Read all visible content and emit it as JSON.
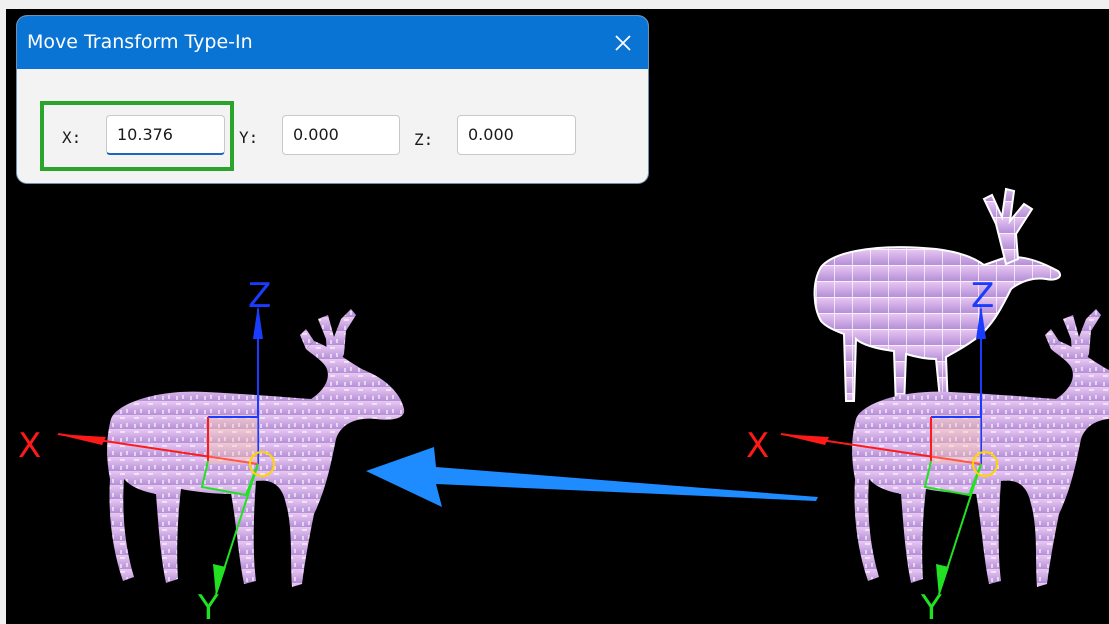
{
  "dialog": {
    "title": "Move Transform Type-In",
    "close_icon": "close-icon",
    "fields": [
      {
        "label": "X:",
        "value": "10.376"
      },
      {
        "label": "Y:",
        "value": "0.000"
      },
      {
        "label": "Z:",
        "value": "0.000"
      }
    ]
  },
  "viewport": {
    "axis_labels": {
      "x": "X",
      "y": "Y",
      "z": "Z"
    },
    "colors": {
      "x_axis": "#ff1a1a",
      "y_axis": "#22e022",
      "z_axis": "#1a3cff",
      "pivot": "#ffd400",
      "direction_arrow": "#1e8bff",
      "highlight": "#2aa42a",
      "titlebar": "#0a74d4"
    }
  }
}
